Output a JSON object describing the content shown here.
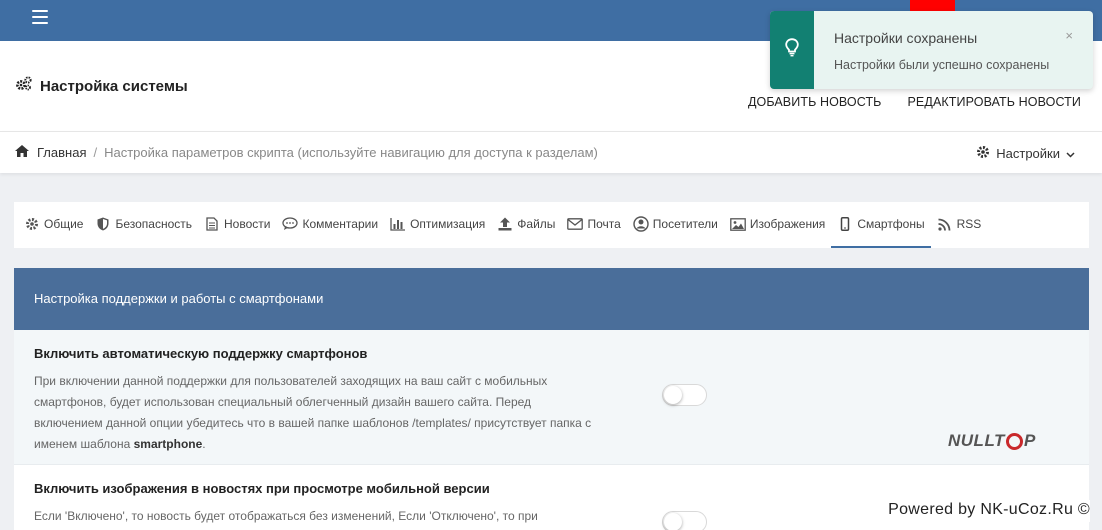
{
  "topbar": {
    "menu_icon": "hamburger-icon",
    "bg_color": "#3f6ea3"
  },
  "header": {
    "title": "Настройка системы",
    "title_icon": "gears-icon",
    "links": [
      "ДОБАВИТЬ НОВОСТЬ",
      "РЕДАКТИРОВАТЬ НОВОСТИ"
    ]
  },
  "breadcrumb": {
    "home_icon": "home-icon",
    "home": "Главная",
    "separator": "/",
    "current": "Настройка параметров скрипта (используйте навигацию для доступа к разделам)",
    "settings_label": "Настройки"
  },
  "tabs": [
    {
      "label": "Общие",
      "icon": "gear-icon"
    },
    {
      "label": "Безопасность",
      "icon": "shield-icon"
    },
    {
      "label": "Новости",
      "icon": "file-icon"
    },
    {
      "label": "Комментарии",
      "icon": "comments-icon"
    },
    {
      "label": "Оптимизация",
      "icon": "bar-chart-icon"
    },
    {
      "label": "Файлы",
      "icon": "upload-icon"
    },
    {
      "label": "Почта",
      "icon": "envelope-icon"
    },
    {
      "label": "Посетители",
      "icon": "user-circle-icon"
    },
    {
      "label": "Изображения",
      "icon": "image-icon"
    },
    {
      "label": "Смартфоны",
      "icon": "mobile-icon",
      "active": true
    },
    {
      "label": "RSS",
      "icon": "rss-icon"
    }
  ],
  "panel": {
    "header": "Настройка поддержки и работы с смартфонами",
    "rows": [
      {
        "title": "Включить автоматическую поддержку смартфонов",
        "desc": "При включении данной поддержки для пользователей заходящих на ваш сайт с мобильных смартфонов, будет использован специальный облегченный дизайн вашего сайта. Перед включением данной опции убедитесь что в вашей папке шаблонов /templates/ присутствует папка с именем шаблона ",
        "desc_bold": "smartphone",
        "desc_end": ".",
        "enabled": false
      },
      {
        "title": "Включить изображения в новостях при просмотре мобильной версии",
        "desc": "Если 'Включено', то новость будет отображаться без изменений, Если 'Отключено', то при",
        "enabled": false
      }
    ]
  },
  "toast": {
    "icon": "lightbulb-icon",
    "title": "Настройки сохранены",
    "message": "Настройки были успешно сохранены",
    "close": "×",
    "accent_color": "#128072"
  },
  "watermark": {
    "prefix": "NULLT",
    "suffix": "P"
  },
  "footer": {
    "powered": "Powered by NK-uCoz.Ru ©"
  }
}
